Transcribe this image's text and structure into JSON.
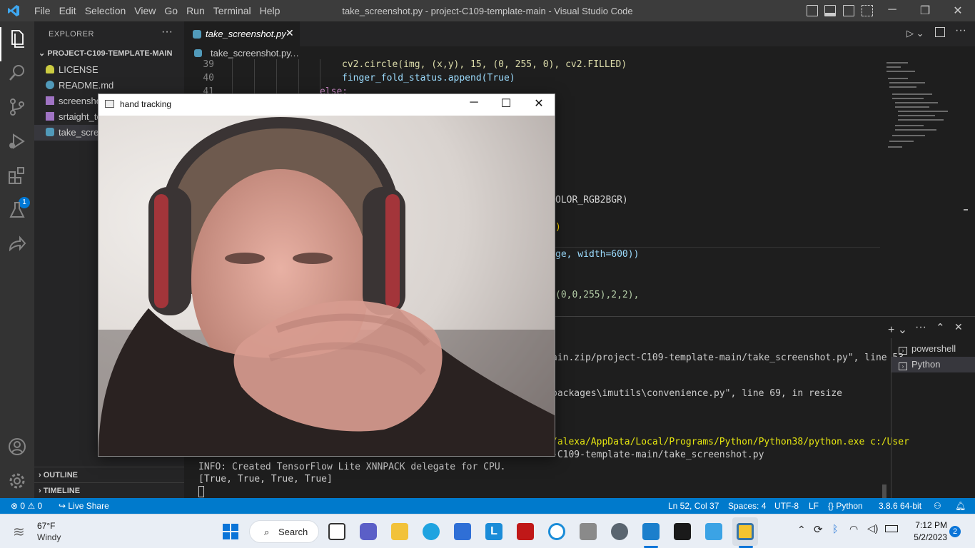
{
  "titlebar": {
    "menu": [
      "File",
      "Edit",
      "Selection",
      "View",
      "Go",
      "Run",
      "Terminal",
      "Help"
    ],
    "title": "take_screenshot.py - project-C109-template-main - Visual Studio Code"
  },
  "activity": {
    "extensions_badge": "1"
  },
  "sidebar": {
    "header": "EXPLORER",
    "more": "···",
    "folder": "PROJECT-C109-TEMPLATE-MAIN",
    "files": [
      {
        "name": "LICENSE",
        "icon": "license-icon"
      },
      {
        "name": "README.md",
        "icon": "info-icon"
      },
      {
        "name": "screenshot",
        "icon": "image-icon"
      },
      {
        "name": "srtaight_te",
        "icon": "image-icon"
      },
      {
        "name": "take_scree",
        "icon": "python-icon"
      }
    ],
    "outline": "OUTLINE",
    "timeline": "TIMELINE"
  },
  "editor": {
    "tab": "take_screenshot.py",
    "breadcrumb_file": "take_screenshot.py",
    "breadcrumb_more": "…",
    "lines": [
      {
        "n": "39",
        "text": "cv2.circle(img, (x,y), 15, (0, 255, 0), cv2.FILLED)"
      },
      {
        "n": "40",
        "text": "finger_fold_status.append(True)"
      },
      {
        "n": "41",
        "text": "else:"
      }
    ],
    "partial_lines": [
      "OLOR_RGB2BGR)",
      ")",
      "ge, width=600))",
      "(0,0,255),2,2),"
    ]
  },
  "panel": {
    "terminals": [
      "powershell",
      "Python"
    ],
    "output": [
      "ain.zip/project-C109-template-main/take_screenshot.py\", line 53,",
      "packages\\imutils\\convenience.py\", line 69, in resize",
      "/alexa/AppData/Local/Programs/Python/Python38/python.exe c:/User",
      "-C109-template-main/take_screenshot.py",
      "INFO: Created TensorFlow Lite XNNPACK delegate for CPU.",
      "[True, True, True, True]"
    ]
  },
  "camera_window": {
    "title": "hand tracking"
  },
  "status": {
    "errors": "0",
    "warnings": "0",
    "live_share": "Live Share",
    "position": "Ln 52, Col 37",
    "spaces": "Spaces: 4",
    "encoding": "UTF-8",
    "eol": "LF",
    "language": "Python",
    "interpreter": "3.8.6 64-bit"
  },
  "taskbar": {
    "temp": "67°F",
    "weather": "Windy",
    "search": "Search",
    "time": "7:12 PM",
    "date": "5/2/2023",
    "notifications": "2"
  },
  "colors": {
    "accent": "#007acc",
    "editor_bg": "#1e1e1e",
    "sidebar_bg": "#252526",
    "activity_bg": "#333333"
  }
}
